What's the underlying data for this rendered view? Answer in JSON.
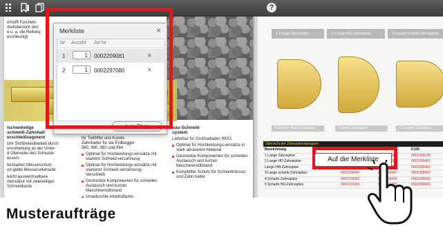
{
  "topbar": {
    "help_glyph": "?",
    "icons": [
      "grid-icon",
      "bookmark-icon",
      "pages-icon",
      "help-icon"
    ]
  },
  "left_page": {
    "col1_top": [
      "erhofft Furcheln",
      "rbeitsbereich des",
      "e u. a. die Reifung",
      "eschleunigt"
    ],
    "col1_head": [
      "ischenkelige",
      "schweiß-Zahnhalt",
      "erschleißsegment"
    ],
    "col1_text": [
      "che Stoßbelastbarkeit durch",
      "ervorhebung an der Unter-",
      "d Oberseite des Schaufel-",
      "essers",
      "lenstarker Messerschutz",
      "nd glatte Messerunterseite",
      "leicht auswechselbare",
      "rteinsätze mit zweiseitiger",
      "Schneidkante"
    ],
    "col2": [
      "für Tieflöffel und Kombi-",
      "Zahnhalter für die Erdbagger",
      "980, 990, 992 und 994"
    ],
    "col2_bullets": [
      "Optimal für Hochleistungs-einsätze mit starkem Schneid-verzahnung",
      "Optimal für Hochleistungs-einsätze mit starkerer Schneid verzahnung-Verschleiß",
      "Gestreckte Komponenten für schnellen Austausch und kurzen Maschinenstillstand",
      "Ungefurchte Arbeitsfläche"
    ],
    "col3_head": [
      "bau-Schneid-",
      "system"
    ],
    "col3_text": [
      "Lieferbar für Großradlader 992G"
    ],
    "col3_bullets": [
      "Optimal für Hochleistungs-einsätze in stark abrasivem Material",
      "Gestreckte Komponenten für schnellen Austausch und kurzen Maschinenstillstand",
      "Kompletter Schutz für Schneidmesser und Zahn halter"
    ]
  },
  "right_page": {
    "strip_labels": [
      "1 Lange Zahnspitze",
      "2 Lange HD-Zahnspitze",
      "3 Lange scharfe Zahnspitze"
    ],
    "tooth_labels": [
      "4 Scharfe Plan Zahnspitze",
      "5 Breite Zahnspitze",
      "6 Scharfe Zahnspitze"
    ],
    "table_title": "Übersicht der Zahnspitzengruppen",
    "table_header": [
      "Bezeichnung",
      "K80",
      "K90",
      "K100"
    ],
    "table_rows": [
      [
        "1 Lange Zahnspitze",
        "0002209081",
        "0002209081",
        "0002309169"
      ],
      [
        "2 Lange HD-Zahnspitze",
        "0002209082",
        "0002209082",
        "0002309401"
      ],
      [
        "Lange HM-Zahnspitze",
        "0002297080",
        "0002297080",
        "0002309402"
      ],
      [
        "3 Lange scharfe Zahnspitze",
        "0002209087",
        "0002209087",
        "0002309603"
      ],
      [
        "4 Scharfe Zahnspitze",
        "0002209092",
        "0002209092",
        "0002309604"
      ],
      [
        "5 Scharfe HD-Zahnspitze",
        "0002231091",
        "0002231091",
        "0002309605"
      ]
    ]
  },
  "dialog": {
    "title": "Merkliste",
    "close_glyph": "×",
    "columns": [
      "Nr",
      "Anzahl",
      "Art Nr"
    ],
    "rows": [
      {
        "nr": "1",
        "qty": "1",
        "art": "0002209081",
        "delete_glyph": "×"
      },
      {
        "nr": "2",
        "qty": "1",
        "art": "0002297080",
        "delete_glyph": "×"
      }
    ],
    "shop_button": "zum Shop"
  },
  "merkliste_button": "Auf die Merkliste",
  "bottom_heading": "Musteraufträge",
  "colors": {
    "highlight": "#e4161c",
    "accent_yellow": "#e8d872",
    "topbar": "#4a4a4a"
  }
}
